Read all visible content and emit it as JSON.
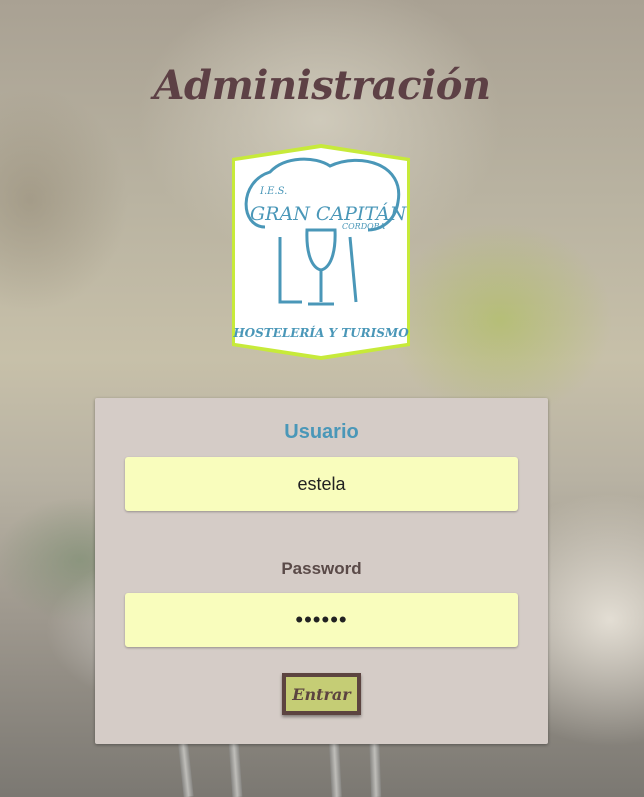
{
  "page": {
    "title": "Administración"
  },
  "logo": {
    "line1": "I.E.S.",
    "line2": "GRAN CAPITÁN",
    "line3": "CORDOBA",
    "line4": "HOSTELERÍA Y TURISMO",
    "border_color": "#c7ea3a",
    "ink_color": "#4a97b8"
  },
  "login": {
    "user_label": "Usuario",
    "user_value": "estela",
    "password_label": "Password",
    "password_value": "••••••",
    "submit_label": "Entrar"
  },
  "colors": {
    "title": "#5d4045",
    "card": "#d5ccc7",
    "field": "#f9fdbd",
    "button": "#c5cd75",
    "button_border": "#5c4440",
    "user_label": "#4a97b8"
  }
}
